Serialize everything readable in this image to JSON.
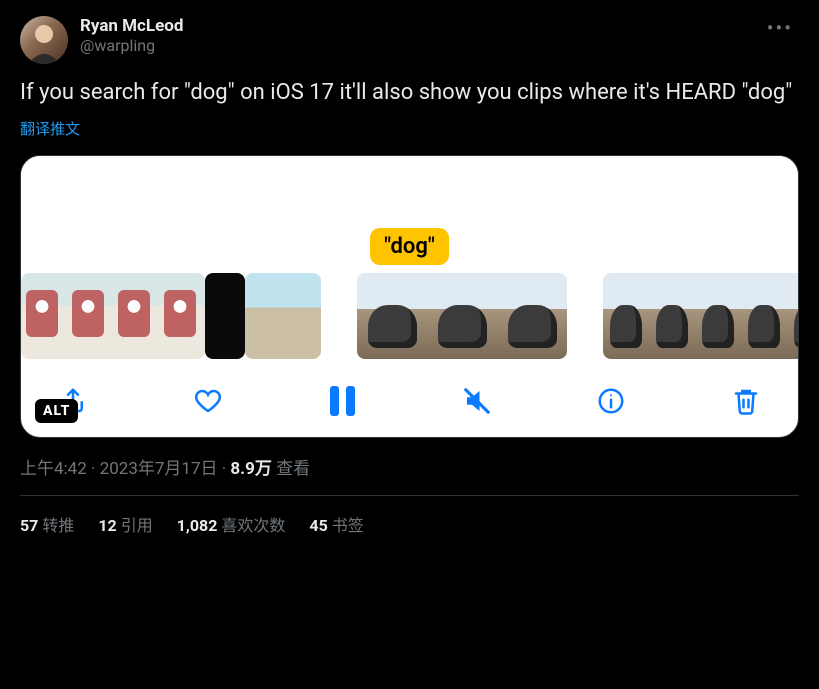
{
  "author": {
    "display_name": "Ryan McLeod",
    "handle": "@warpling"
  },
  "tweet_text": "If you search for \"dog\" on iOS 17 it'll also show you clips where it's HEARD \"dog\"",
  "translate_label": "翻译推文",
  "media": {
    "caption_bubble": "\"dog\"",
    "alt_badge": "ALT",
    "toolbar": {
      "share": "share",
      "like": "like",
      "pause": "pause",
      "mute": "mute",
      "info": "info",
      "delete": "delete"
    }
  },
  "meta": {
    "time": "上午4:42",
    "dot1": " · ",
    "date": "2023年7月17日",
    "dot2": " · ",
    "views_count": "8.9万",
    "views_label": " 查看"
  },
  "stats": {
    "retweets_n": "57",
    "retweets_l": "转推",
    "quotes_n": "12",
    "quotes_l": "引用",
    "likes_n": "1,082",
    "likes_l": "喜欢次数",
    "bookmarks_n": "45",
    "bookmarks_l": "书签"
  }
}
